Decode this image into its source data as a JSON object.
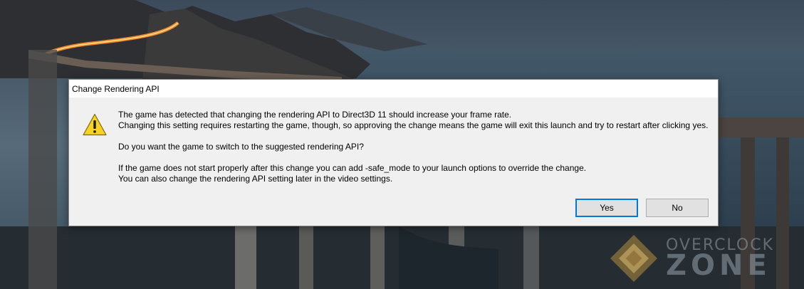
{
  "dialog": {
    "title": "Change Rendering API",
    "icon": "warning-icon",
    "message": {
      "para1_line1": "The game has detected that changing the rendering API to Direct3D 11 should increase your frame rate.",
      "para1_line2": "Changing this setting requires restarting the game, though, so approving the change means the game will exit this launch and try to restart after clicking yes.",
      "para2": "Do you want the game to switch to the suggested rendering API?",
      "para3_line1": "If the game does not start properly after this change you can add -safe_mode to your launch options to override the change.",
      "para3_line2": "You can also change the rendering API setting later in the video settings."
    },
    "buttons": {
      "yes_label": "Yes",
      "no_label": "No"
    }
  },
  "watermark": {
    "line1": "OVERCLOCK",
    "line2": "ZONE"
  },
  "colors": {
    "dialog_bg": "#f0f0f0",
    "titlebar_bg": "#ffffff",
    "focus_border": "#0078d7",
    "warning_yellow": "#f7d21e"
  }
}
